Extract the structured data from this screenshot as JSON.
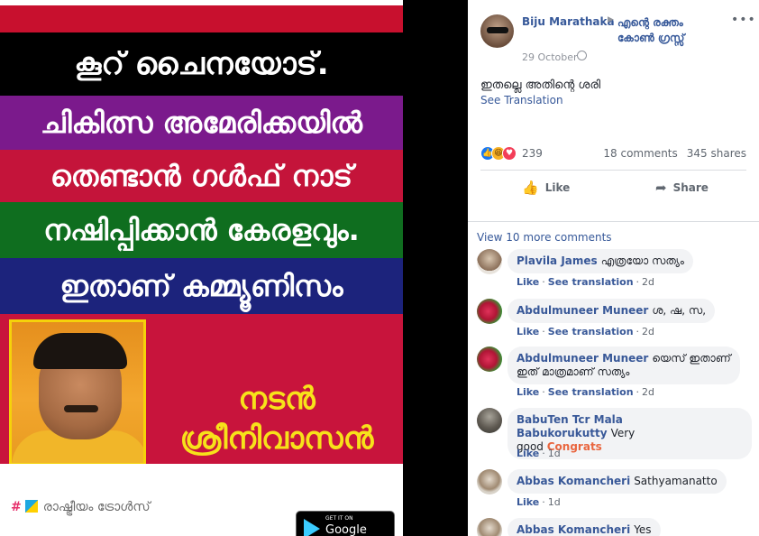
{
  "poster": {
    "line1": "കൂറ് ചൈനയോട്.",
    "line2": "ചികിത്സ അമേരിക്കയിൽ",
    "line3": "തെണ്ടാൻ ഗൾഫ് നാട്",
    "line4": "നഷിപ്പിക്കാൻ കേരളവും.",
    "line5": "ഇതാണ് കമ്മ്യൂണിസം",
    "actor_title": "നടൻ",
    "actor_name": "ശ്രീനിവാസൻ",
    "brand_hash": "#",
    "brand_text": "രാഷ്ട്രീയം ട്രോൾസ്",
    "store_small": "GET IT ON",
    "store_big": "Google Play"
  },
  "post": {
    "author": "Biju Marathaka",
    "arrow": "▶",
    "group": "എന്റെ രക്തം കോൺ ഗ്രസ്സ്",
    "menu": "•••",
    "date": "29 October",
    "text": "ഇതല്ലെ അതിന്റെ ശരി",
    "see_translation": "See Translation",
    "reaction_count": "239",
    "comments_count": "18 comments",
    "shares_count": "345 shares",
    "like_label": "Like",
    "share_label": "Share",
    "like_icon": "thumb-up-icon",
    "share_icon": "share-arrow-icon"
  },
  "comments": {
    "view_more": "View 10 more comments",
    "like_label": "Like",
    "see_translation_label": "See translation",
    "items": [
      {
        "name": "Plavila James",
        "text": "എത്രയോ സത്യം",
        "tag": "",
        "time": "2d"
      },
      {
        "name": "Abdulmuneer Muneer",
        "text": "ശ, ഷ, സ,",
        "tag": "",
        "time": "2d"
      },
      {
        "name": "Abdulmuneer Muneer",
        "text": "യെസ് ഇതാണ്",
        "text2": "ഇത് മാത്രമാണ് സത്യം",
        "tag": "",
        "time": "2d"
      },
      {
        "name": "BabuTen Tcr Mala Babukorukutty",
        "text": "Very",
        "text2": "good",
        "tag": "Congrats",
        "time": "1d"
      },
      {
        "name": "Abbas Komancheri",
        "text": "Sathyamanatto",
        "tag": "",
        "time": "1d"
      },
      {
        "name": "Abbas Komancheri",
        "text": "Yes",
        "tag": "",
        "time": ""
      }
    ]
  },
  "colors": {
    "fb_link": "#365899",
    "meta_grey": "#606770",
    "bubble": "#f2f3f5",
    "congrats_orange": "#e9663f"
  }
}
